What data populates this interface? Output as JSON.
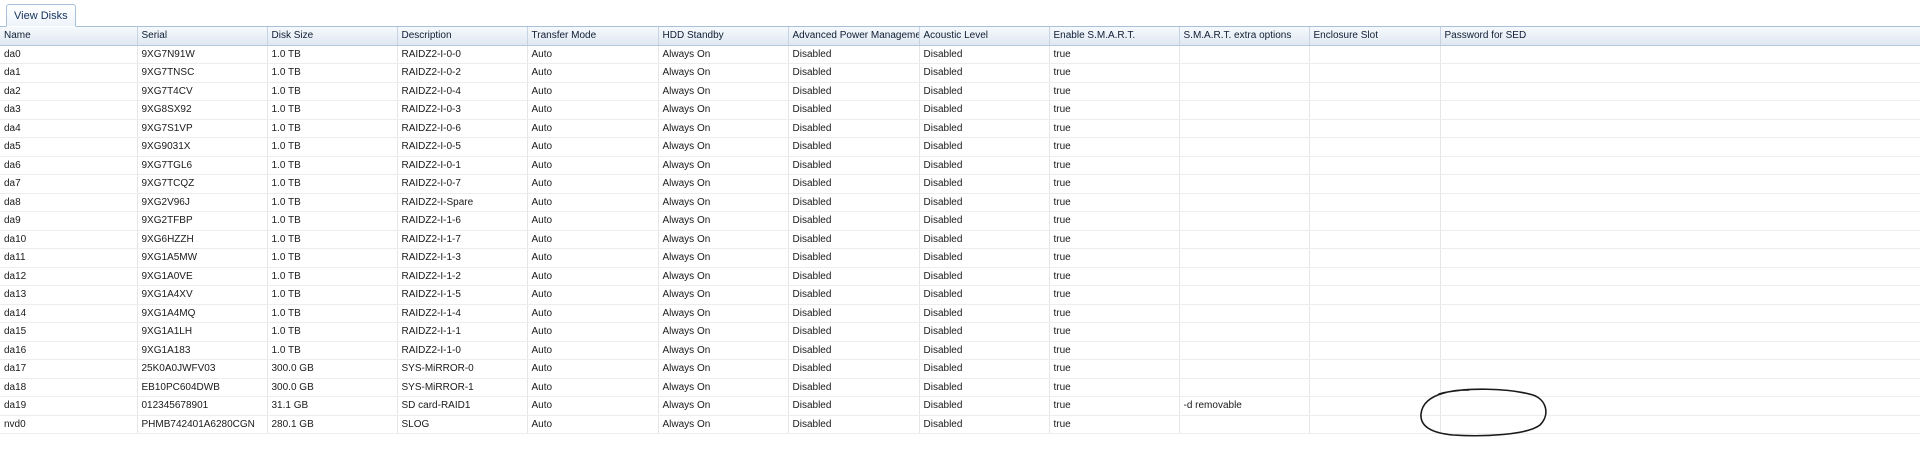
{
  "tab": {
    "label": "View Disks"
  },
  "columns": [
    "Name",
    "Serial",
    "Disk Size",
    "Description",
    "Transfer Mode",
    "HDD Standby",
    "Advanced Power Management",
    "Acoustic Level",
    "Enable S.M.A.R.T.",
    "S.M.A.R.T. extra options",
    "Enclosure Slot",
    "Password for SED"
  ],
  "rows": [
    [
      "da0",
      "9XG7N91W",
      "1.0 TB",
      "RAIDZ2-I-0-0",
      "Auto",
      "Always On",
      "Disabled",
      "Disabled",
      "true",
      "",
      "",
      ""
    ],
    [
      "da1",
      "9XG7TNSC",
      "1.0 TB",
      "RAIDZ2-I-0-2",
      "Auto",
      "Always On",
      "Disabled",
      "Disabled",
      "true",
      "",
      "",
      ""
    ],
    [
      "da2",
      "9XG7T4CV",
      "1.0 TB",
      "RAIDZ2-I-0-4",
      "Auto",
      "Always On",
      "Disabled",
      "Disabled",
      "true",
      "",
      "",
      ""
    ],
    [
      "da3",
      "9XG8SX92",
      "1.0 TB",
      "RAIDZ2-I-0-3",
      "Auto",
      "Always On",
      "Disabled",
      "Disabled",
      "true",
      "",
      "",
      ""
    ],
    [
      "da4",
      "9XG7S1VP",
      "1.0 TB",
      "RAIDZ2-I-0-6",
      "Auto",
      "Always On",
      "Disabled",
      "Disabled",
      "true",
      "",
      "",
      ""
    ],
    [
      "da5",
      "9XG9031X",
      "1.0 TB",
      "RAIDZ2-I-0-5",
      "Auto",
      "Always On",
      "Disabled",
      "Disabled",
      "true",
      "",
      "",
      ""
    ],
    [
      "da6",
      "9XG7TGL6",
      "1.0 TB",
      "RAIDZ2-I-0-1",
      "Auto",
      "Always On",
      "Disabled",
      "Disabled",
      "true",
      "",
      "",
      ""
    ],
    [
      "da7",
      "9XG7TCQZ",
      "1.0 TB",
      "RAIDZ2-I-0-7",
      "Auto",
      "Always On",
      "Disabled",
      "Disabled",
      "true",
      "",
      "",
      ""
    ],
    [
      "da8",
      "9XG2V96J",
      "1.0 TB",
      "RAIDZ2-I-Spare",
      "Auto",
      "Always On",
      "Disabled",
      "Disabled",
      "true",
      "",
      "",
      ""
    ],
    [
      "da9",
      "9XG2TFBP",
      "1.0 TB",
      "RAIDZ2-I-1-6",
      "Auto",
      "Always On",
      "Disabled",
      "Disabled",
      "true",
      "",
      "",
      ""
    ],
    [
      "da10",
      "9XG6HZZH",
      "1.0 TB",
      "RAIDZ2-I-1-7",
      "Auto",
      "Always On",
      "Disabled",
      "Disabled",
      "true",
      "",
      "",
      ""
    ],
    [
      "da11",
      "9XG1A5MW",
      "1.0 TB",
      "RAIDZ2-I-1-3",
      "Auto",
      "Always On",
      "Disabled",
      "Disabled",
      "true",
      "",
      "",
      ""
    ],
    [
      "da12",
      "9XG1A0VE",
      "1.0 TB",
      "RAIDZ2-I-1-2",
      "Auto",
      "Always On",
      "Disabled",
      "Disabled",
      "true",
      "",
      "",
      ""
    ],
    [
      "da13",
      "9XG1A4XV",
      "1.0 TB",
      "RAIDZ2-I-1-5",
      "Auto",
      "Always On",
      "Disabled",
      "Disabled",
      "true",
      "",
      "",
      ""
    ],
    [
      "da14",
      "9XG1A4MQ",
      "1.0 TB",
      "RAIDZ2-I-1-4",
      "Auto",
      "Always On",
      "Disabled",
      "Disabled",
      "true",
      "",
      "",
      ""
    ],
    [
      "da15",
      "9XG1A1LH",
      "1.0 TB",
      "RAIDZ2-I-1-1",
      "Auto",
      "Always On",
      "Disabled",
      "Disabled",
      "true",
      "",
      "",
      ""
    ],
    [
      "da16",
      "9XG1A183",
      "1.0 TB",
      "RAIDZ2-I-1-0",
      "Auto",
      "Always On",
      "Disabled",
      "Disabled",
      "true",
      "",
      "",
      ""
    ],
    [
      "da17",
      "25K0A0JWFV03",
      "300.0 GB",
      "SYS-MiRROR-0",
      "Auto",
      "Always On",
      "Disabled",
      "Disabled",
      "true",
      "",
      "",
      ""
    ],
    [
      "da18",
      "EB10PC604DWB",
      "300.0 GB",
      "SYS-MiRROR-1",
      "Auto",
      "Always On",
      "Disabled",
      "Disabled",
      "true",
      "",
      "",
      ""
    ],
    [
      "da19",
      "012345678901",
      "31.1 GB",
      "SD card-RAID1",
      "Auto",
      "Always On",
      "Disabled",
      "Disabled",
      "true",
      "-d removable",
      "",
      ""
    ],
    [
      "nvd0",
      "PHMB742401A6280CGN",
      "280.1 GB",
      "SLOG",
      "Auto",
      "Always On",
      "Disabled",
      "Disabled",
      "true",
      "",
      "",
      ""
    ]
  ],
  "colors": {
    "header_bg": "#dfe8f2",
    "tab_text": "#15325a",
    "grid_line": "#e6e6e6",
    "annotation_ink": "#1a1a1a"
  }
}
